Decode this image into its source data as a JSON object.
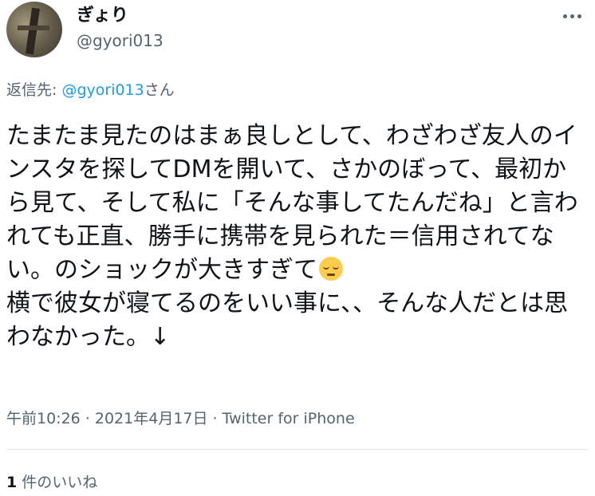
{
  "author": {
    "name": "ぎょり",
    "handle": "@gyori013",
    "avatar_icon": "avatar"
  },
  "more_icon": "more-icon",
  "reply": {
    "prefix": "返信先: ",
    "target": "@gyori013",
    "suffix": "さん"
  },
  "tweet": {
    "part1": "たまたま見たのはまぁ良しとして、わざわざ友人のインスタを探してDMを開いて、さかのぼって、最初から見て、そして私に「そんな事してたんだね」と言われても正直、勝手に携帯を見られた＝信用されてない。のショックが大きすぎて",
    "emoji": "pensive-face",
    "part2": "\n横で彼女が寝てるのをいい事に、、そんな人だとは思わなかった。↓"
  },
  "meta": {
    "text": "午前10:26 · 2021年4月17日 · Twitter for iPhone"
  },
  "likes": {
    "count": "1",
    "label": "件のいいね"
  }
}
